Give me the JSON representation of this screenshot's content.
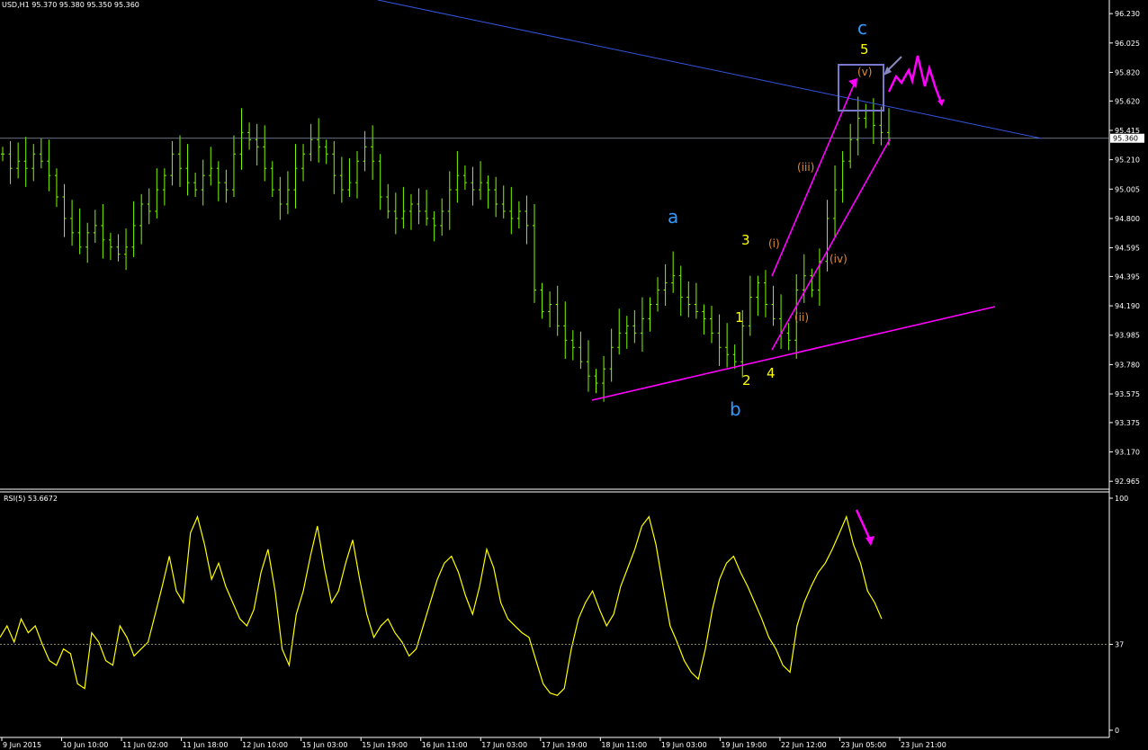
{
  "header": {
    "symbol_tf": "USD,H1",
    "ohlc": "95.370 95.380 95.350 95.360",
    "rsi_label": "RSI(5) 53.6672"
  },
  "colors": {
    "background": "#000000",
    "candles": "#7CFC00",
    "rsi": "#FFFF00",
    "channel": "#FF00FF",
    "trendline": "#3355DD",
    "wave_major": "#3399FF",
    "wave_minor": "#FFFF00",
    "wave_sub": "#E08A3C",
    "box": "#7777CC",
    "axis_text": "#FFFFFF",
    "grid": "#8899AA"
  },
  "chart_data": [
    {
      "type": "candlestick",
      "title": "USD,H1",
      "ylim": [
        92.96,
        96.3
      ],
      "y_ticks": [
        "96.230",
        "96.025",
        "95.820",
        "95.620",
        "95.415",
        "95.210",
        "95.005",
        "94.800",
        "94.595",
        "94.395",
        "94.190",
        "93.985",
        "93.780",
        "93.575",
        "93.375",
        "93.170",
        "92.965"
      ],
      "current_price": "95.360",
      "x_ticks": [
        "9 Jun 2015",
        "10 Jun 10:00",
        "11 Jun 02:00",
        "11 Jun 18:00",
        "12 Jun 10:00",
        "15 Jun 03:00",
        "15 Jun 19:00",
        "16 Jun 11:00",
        "17 Jun 03:00",
        "17 Jun 19:00",
        "18 Jun 11:00",
        "19 Jun 03:00",
        "19 Jun 19:00",
        "22 Jun 12:00",
        "23 Jun 05:00",
        "23 Jun 21:00"
      ],
      "closes": [
        95.25,
        95.15,
        95.2,
        95.15,
        95.25,
        95.2,
        95.1,
        94.95,
        94.8,
        94.7,
        94.6,
        94.7,
        94.75,
        94.65,
        94.6,
        94.55,
        94.6,
        94.75,
        94.9,
        94.85,
        95.0,
        95.1,
        95.25,
        95.15,
        95.05,
        95.0,
        95.1,
        95.15,
        95.05,
        95.0,
        95.25,
        95.4,
        95.35,
        95.3,
        95.15,
        95.0,
        94.9,
        95.0,
        95.15,
        95.25,
        95.35,
        95.3,
        95.25,
        95.1,
        95.0,
        95.05,
        95.2,
        95.3,
        95.2,
        94.95,
        94.85,
        94.8,
        94.85,
        94.9,
        94.85,
        94.8,
        94.75,
        94.85,
        95.0,
        95.1,
        95.05,
        95.0,
        95.05,
        95.0,
        94.9,
        94.85,
        94.8,
        94.85,
        94.75,
        94.3,
        94.15,
        94.2,
        94.05,
        93.95,
        93.9,
        93.8,
        93.7,
        93.65,
        93.75,
        93.9,
        94.0,
        94.05,
        94.0,
        94.1,
        94.2,
        94.3,
        94.35,
        94.4,
        94.25,
        94.2,
        94.15,
        94.1,
        94.0,
        93.9,
        93.85,
        93.8,
        94.05,
        94.25,
        94.35,
        94.2,
        94.1,
        94.0,
        93.95,
        94.3,
        94.4,
        94.3,
        94.5,
        94.8,
        95.0,
        95.2,
        95.35,
        95.5,
        95.55,
        95.45,
        95.4,
        95.36
      ],
      "annotations": [
        "a",
        "b",
        "c",
        "1",
        "2",
        "3",
        "4",
        "5",
        "(i)",
        "(ii)",
        "(iii)",
        "(iv)",
        "(v)"
      ]
    },
    {
      "type": "line",
      "title": "RSI(5) 53.6672",
      "ylim": [
        0,
        100
      ],
      "y_ticks": [
        "100",
        "37",
        "0"
      ],
      "level": 37,
      "values": [
        40,
        45,
        38,
        48,
        42,
        45,
        37,
        30,
        28,
        35,
        33,
        20,
        18,
        42,
        38,
        30,
        28,
        45,
        40,
        32,
        35,
        38,
        50,
        62,
        75,
        60,
        55,
        85,
        92,
        80,
        65,
        72,
        62,
        55,
        48,
        45,
        52,
        68,
        78,
        60,
        35,
        28,
        50,
        60,
        75,
        88,
        70,
        55,
        60,
        72,
        82,
        65,
        50,
        40,
        45,
        48,
        42,
        38,
        32,
        35,
        45,
        55,
        65,
        72,
        75,
        68,
        58,
        50,
        62,
        78,
        70,
        55,
        48,
        45,
        42,
        40,
        30,
        20,
        16,
        15,
        18,
        35,
        48,
        55,
        60,
        52,
        45,
        50,
        62,
        70,
        78,
        88,
        92,
        80,
        62,
        45,
        38,
        30,
        25,
        22,
        35,
        52,
        65,
        72,
        75,
        68,
        62,
        55,
        48,
        40,
        35,
        28,
        25,
        45,
        55,
        62,
        68,
        72,
        78,
        85,
        92,
        80,
        72,
        60,
        55,
        48
      ]
    }
  ]
}
